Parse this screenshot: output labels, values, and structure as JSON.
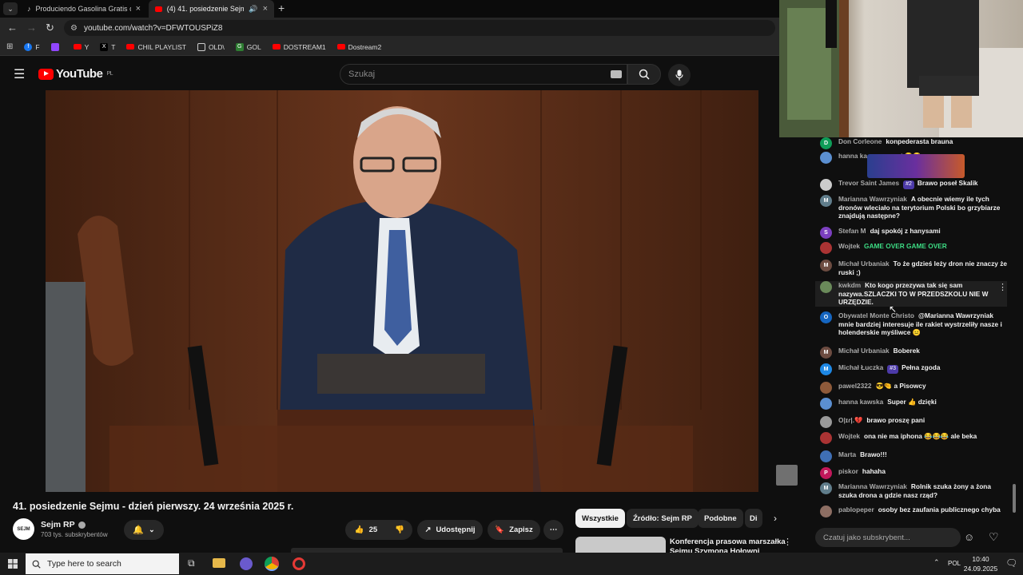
{
  "browser": {
    "tabs": [
      {
        "title": "Produciendo Gasolina Gratis co",
        "active": false
      },
      {
        "title": "(4) 41. posiedzenie Sejmu -",
        "active": true
      }
    ],
    "url": "youtube.com/watch?v=DFWTOUSPiZ8",
    "bookmarks": [
      {
        "label": "F",
        "color": "#1877f2"
      },
      {
        "label": "",
        "color": "#9146ff"
      },
      {
        "label": "Y",
        "color": "#ff0000"
      },
      {
        "label": "T",
        "color": "#000000"
      },
      {
        "label": "CHIL PLAYLIST",
        "color": "#ff0000"
      },
      {
        "label": "OLD\\",
        "color": "#444444"
      },
      {
        "label": "GOL",
        "color": "#2e7d32"
      },
      {
        "label": "DOSTREAM1",
        "color": "#ff0000"
      },
      {
        "label": "Dostream2",
        "color": "#ff0000"
      }
    ]
  },
  "youtube": {
    "logo_text": "YouTube",
    "region": "PL",
    "search_placeholder": "Szukaj"
  },
  "video": {
    "title": "41. posiedzenie Sejmu - dzień pierwszy. 24 września 2025 r.",
    "channel_name": "Sejm RP",
    "channel_avatar_text": "SEJM",
    "subscribers": "703 tys. subskrybentów",
    "likes": "25",
    "share_label": "Udostępnij",
    "save_label": "Zapisz"
  },
  "chips": [
    "Wszystkie",
    "Źródło: Sejm RP",
    "Podobne",
    "Di"
  ],
  "recommended": {
    "title_line1": "Konferencja prasowa marszałka",
    "title_line2": "Sejmu Szymona Hołowni"
  },
  "chat": {
    "messages": [
      {
        "author": "Don Corleone",
        "text": "konpederasta brauna",
        "avatar": "D",
        "color": "#0f9d58"
      },
      {
        "author": "hanna ka",
        "text": "n moment 😂😂",
        "avatar": "",
        "color": "#5b8fd1"
      },
      {
        "author": "Trevor Saint James",
        "badge": "#2",
        "text": "Brawo poseł Skalik",
        "avatar": "",
        "color": "#cccccc"
      },
      {
        "author": "Marianna Wawrzyniak",
        "text": "A obecnie wiemy ile tych dronów wleciało na terytorium Polski bo grzybiarze znajdują następne?",
        "avatar": "M",
        "color": "#607d8b"
      },
      {
        "author": "Stefan M",
        "text": "daj spokój z hanysami",
        "avatar": "S",
        "color": "#7b3fbf"
      },
      {
        "author": "Wojtek",
        "text": "GAME OVER GAME OVER",
        "avatar": "",
        "color": "#aa3333"
      },
      {
        "author": "Michał Urbaniak",
        "text": "To że gdzieś leży dron nie znaczy że ruski ;)",
        "avatar": "M",
        "color": "#6d4c41"
      },
      {
        "author": "kwkdm",
        "text": "Kto kogo przezywa tak się sam nazywa.SZLACZKI TO W PRZEDSZKOLU NIE W URZĘDZIE.",
        "avatar": "",
        "color": "#6a8a5a"
      },
      {
        "author": "Obywatel Monte Christo",
        "text": "@Marianna Wawrzyniak mnie bardziej interesuje ile rakiet wystrzeliły nasze i holenderskie myśliwce 😐",
        "avatar": "O",
        "color": "#1565c0"
      },
      {
        "author": "Michał Urbaniak",
        "text": "Boberek",
        "avatar": "M",
        "color": "#6d4c41"
      },
      {
        "author": "Michał Łuczka",
        "badge": "#3",
        "text": "Pełna zgoda",
        "avatar": "M",
        "color": "#1e88e5"
      },
      {
        "author": "pawel2322",
        "text": "😎🤏 a Pisowcy",
        "avatar": "",
        "color": "#8e5a3a"
      },
      {
        "author": "hanna kawska",
        "text": "Super 👍 dzięki",
        "avatar": "",
        "color": "#5b8fd1"
      },
      {
        "author": "O|ɪɾ|.💔",
        "text": "brawo proszę pani",
        "avatar": "",
        "color": "#999999"
      },
      {
        "author": "Wojtek",
        "text": "ona nie ma iphona 😂😂😂 ale beka",
        "avatar": "",
        "color": "#aa3333"
      },
      {
        "author": "Marta",
        "text": "Brawo!!!",
        "avatar": "",
        "color": "#3f6fb5"
      },
      {
        "author": "piskor",
        "text": "hahaha",
        "avatar": "P",
        "color": "#c2185b"
      },
      {
        "author": "Marianna Wawrzyniak",
        "text": "Rolnik szuka żony a żona szuka drona a gdzie nasz rząd?",
        "avatar": "M",
        "color": "#607d8b"
      },
      {
        "author": "pablopeper",
        "text": "osoby bez zaufania publicznego chyba",
        "avatar": "",
        "color": "#8d6e63"
      }
    ],
    "input_placeholder": "Czatuj jako subskrybent..."
  },
  "taskbar": {
    "search_placeholder": "Type here to search",
    "language": "POL",
    "time": "10:40",
    "date": "24.09.2025"
  }
}
